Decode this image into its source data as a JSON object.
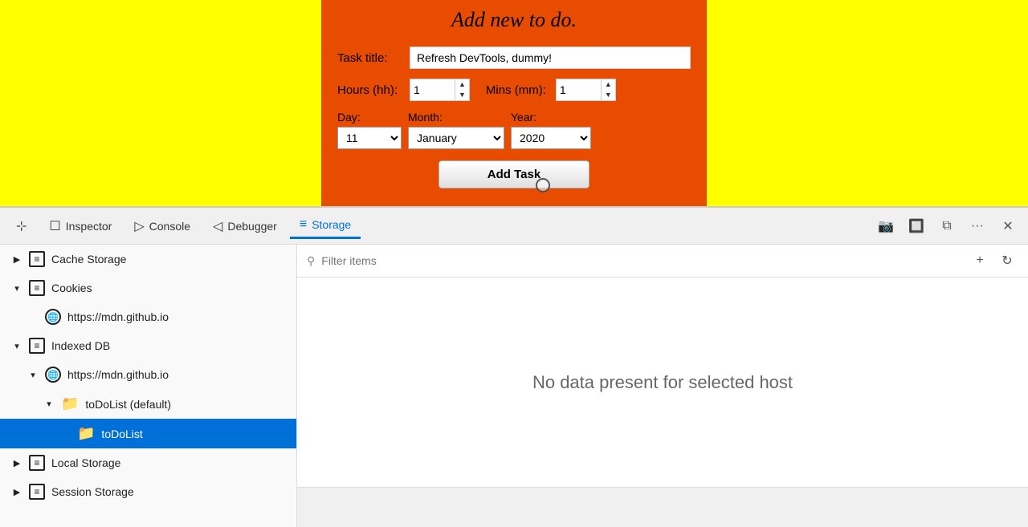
{
  "app": {
    "title": "Add new to do.",
    "task_label": "Task title:",
    "task_value": "Refresh DevTools, dummy!",
    "hours_label": "Hours (hh):",
    "hours_value": "1",
    "mins_label": "Mins (mm):",
    "mins_value": "1",
    "day_label": "Day:",
    "day_value": "11",
    "month_label": "Month:",
    "month_value": "January",
    "year_label": "Year:",
    "year_value": "2020",
    "add_btn": "Add Task"
  },
  "devtools": {
    "tabs": [
      {
        "id": "pick",
        "label": "",
        "icon": "⊹",
        "active": false
      },
      {
        "id": "inspector",
        "label": "Inspector",
        "icon": "☐",
        "active": false
      },
      {
        "id": "console",
        "label": "Console",
        "icon": "▷",
        "active": false
      },
      {
        "id": "debugger",
        "label": "Debugger",
        "icon": "◁",
        "active": false
      },
      {
        "id": "storage",
        "label": "Storage",
        "icon": "≡",
        "active": true
      }
    ],
    "actions": [
      "📷",
      "🔲",
      "⧉",
      "···",
      "✕"
    ],
    "filter_placeholder": "Filter items"
  },
  "sidebar": {
    "items": [
      {
        "id": "cache-storage",
        "label": "Cache Storage",
        "indent": 0,
        "chevron": "▶",
        "icon": "box",
        "selected": false
      },
      {
        "id": "cookies",
        "label": "Cookies",
        "indent": 0,
        "chevron": "▾",
        "icon": "box",
        "selected": false
      },
      {
        "id": "cookies-mdn",
        "label": "https://mdn.github.io",
        "indent": 1,
        "chevron": "",
        "icon": "globe",
        "selected": false
      },
      {
        "id": "indexed-db",
        "label": "Indexed DB",
        "indent": 0,
        "chevron": "▾",
        "icon": "box",
        "selected": false
      },
      {
        "id": "indexed-db-mdn",
        "label": "https://mdn.github.io",
        "indent": 1,
        "chevron": "▾",
        "icon": "globe",
        "selected": false
      },
      {
        "id": "todolist-default",
        "label": "toDoList (default)",
        "indent": 2,
        "chevron": "▾",
        "icon": "folder",
        "selected": false
      },
      {
        "id": "todolist",
        "label": "toDoList",
        "indent": 3,
        "chevron": "",
        "icon": "folder",
        "selected": true
      },
      {
        "id": "local-storage",
        "label": "Local Storage",
        "indent": 0,
        "chevron": "▶",
        "icon": "box",
        "selected": false
      },
      {
        "id": "session-storage",
        "label": "Session Storage",
        "indent": 0,
        "chevron": "▶",
        "icon": "box",
        "selected": false
      }
    ]
  },
  "main": {
    "empty_message": "No data present for selected host"
  }
}
